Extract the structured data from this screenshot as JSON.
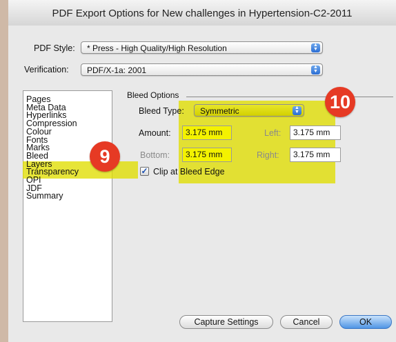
{
  "window": {
    "title": "PDF Export Options for New challenges in Hypertension-C2-2011"
  },
  "pdf_style": {
    "label": "PDF Style:",
    "value": "* Press - High Quality/High Resolution"
  },
  "verification": {
    "label": "Verification:",
    "value": "PDF/X-1a: 2001"
  },
  "sidebar": {
    "items": [
      "Pages",
      "Meta Data",
      "Hyperlinks",
      "Compression",
      "Colour",
      "Fonts",
      "Marks",
      "Bleed",
      "Layers",
      "Transparency",
      "OPI",
      "JDF",
      "Summary"
    ],
    "selected": "Bleed"
  },
  "bleed_options": {
    "group_title": "Bleed Options",
    "type_label": "Bleed Type:",
    "type_value": "Symmetric",
    "amount_label": "Amount:",
    "amount_value": "3.175 mm",
    "left_label": "Left:",
    "left_value": "3.175 mm",
    "bottom_label": "Bottom:",
    "bottom_value": "3.175 mm",
    "right_label": "Right:",
    "right_value": "3.175 mm",
    "clip_label": "Clip at Bleed Edge",
    "clip_checked": true
  },
  "annotations": {
    "badge_sidebar": "9",
    "badge_options": "10",
    "highlight_color": "#e0de00",
    "badge_color": "#e63a24"
  },
  "buttons": {
    "capture": "Capture Settings",
    "cancel": "Cancel",
    "ok": "OK"
  }
}
